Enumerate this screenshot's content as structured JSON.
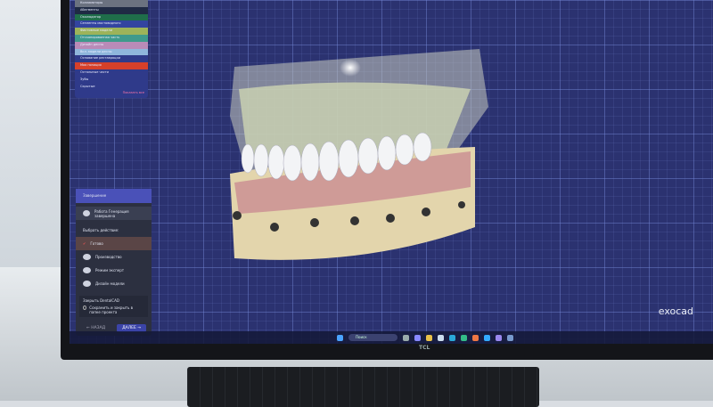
{
  "tree": {
    "items": [
      {
        "label": "Коллиматоры",
        "color": "#6b7280"
      },
      {
        "label": "Абатменты",
        "color": "#1f2a44"
      },
      {
        "label": "Окклюдатор",
        "color": "#1f6e4a"
      },
      {
        "label": "Сегменты мостовидного",
        "color": "#3344a0"
      },
      {
        "label": "Фиктивные модели",
        "color": "#9db35a"
      },
      {
        "label": "Отсканированная часть",
        "color": "#3f9a8c"
      },
      {
        "label": "Дизайн десны",
        "color": "#b98bb8"
      },
      {
        "label": "Вкл. модели десны",
        "color": "#8fb6dc"
      },
      {
        "label": "Основание реставрации",
        "color": "#2f3a8a"
      },
      {
        "label": "Моя позиция",
        "color": "#d6402a"
      },
      {
        "label": "Остальные части",
        "color": "#2f3a8a"
      },
      {
        "label": "Зубы",
        "color": "#2f3a8a"
      },
      {
        "label": "Скрытые",
        "color": "#2f3a8a"
      }
    ],
    "show_all": "Показать все"
  },
  "wizard": {
    "title": "Завершение",
    "project": "Работа Генерация завершена",
    "section": "Выбрать действие:",
    "actions": [
      "Готово",
      "Производство",
      "Режим эксперт",
      "Дизайн модели"
    ],
    "cad_label": "Закрыть DentalCAD",
    "checkbox": "Сохранить и закрыть в папке проекта",
    "back": "← НАЗАД",
    "next": "ДАЛЕЕ →"
  },
  "taskbar": {
    "search": "Поиск"
  },
  "brand": "exocad",
  "monitor_brand": "TCL"
}
